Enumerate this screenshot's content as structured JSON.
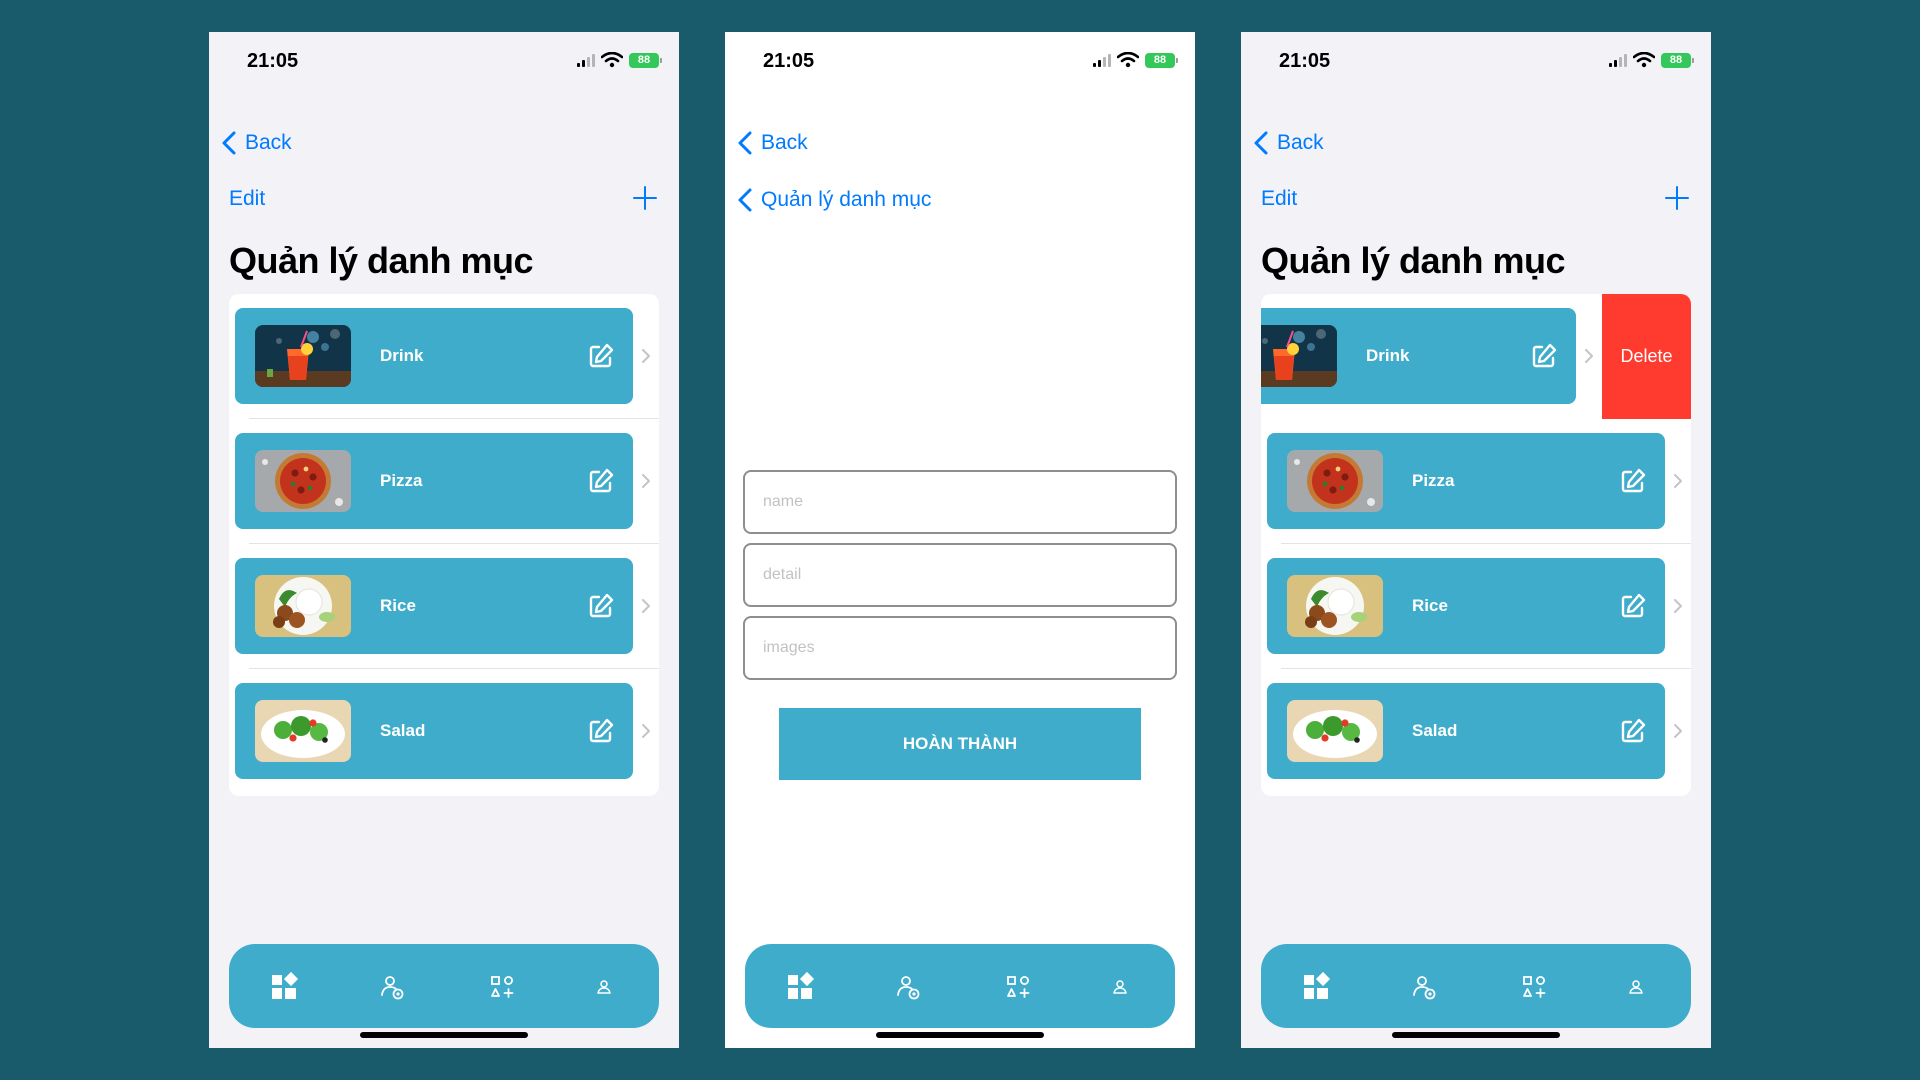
{
  "status": {
    "time": "21:05",
    "battery": "88"
  },
  "colors": {
    "background": "#1a5b6b",
    "accent": "#3faccb",
    "link": "#007aff",
    "delete": "#ff3b30",
    "battery": "#34c759"
  },
  "screen_list": {
    "back_label": "Back",
    "edit_label": "Edit",
    "add_icon": "plus-icon",
    "title": "Quản lý danh mục",
    "categories": [
      {
        "name": "Drink",
        "image": "drink-photo"
      },
      {
        "name": "Pizza",
        "image": "pizza-photo"
      },
      {
        "name": "Rice",
        "image": "rice-photo"
      },
      {
        "name": "Salad",
        "image": "salad-photo"
      }
    ]
  },
  "screen_form": {
    "back_label": "Back",
    "sub_back_label": "Quản lý danh mục",
    "name_placeholder": "name",
    "detail_placeholder": "detail",
    "images_placeholder": "images",
    "submit_label": "HOÀN THÀNH"
  },
  "screen_swipe": {
    "delete_label": "Delete"
  },
  "tabbar": {
    "tabs": [
      "dashboard-icon",
      "user-settings-icon",
      "add-category-icon",
      "profile-icon"
    ]
  }
}
